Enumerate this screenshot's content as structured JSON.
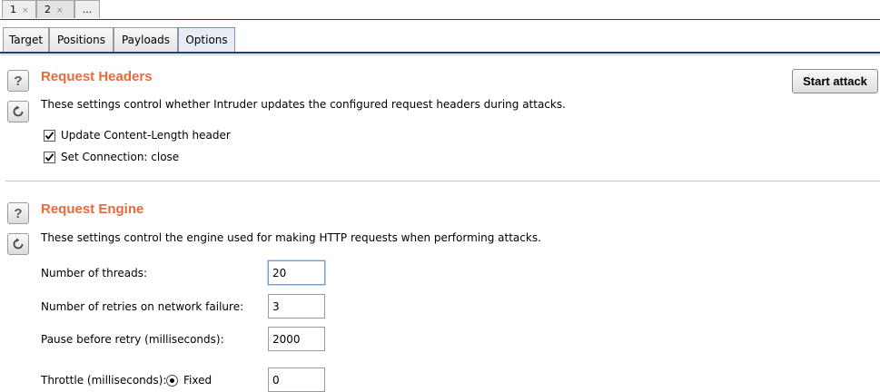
{
  "instance_tabs": [
    {
      "label": "1",
      "close": "×"
    },
    {
      "label": "2",
      "close": "×"
    },
    {
      "label": "..."
    }
  ],
  "sub_tabs": [
    "Target",
    "Positions",
    "Payloads",
    "Options"
  ],
  "active_sub_tab": "Options",
  "start_attack_label": "Start attack",
  "request_headers": {
    "title": "Request Headers",
    "description": "These settings control whether Intruder updates the configured request headers during attacks.",
    "options": [
      {
        "label": "Update Content-Length header",
        "checked": true
      },
      {
        "label": "Set Connection: close",
        "checked": true
      }
    ]
  },
  "request_engine": {
    "title": "Request Engine",
    "description": "These settings control the engine used for making HTTP requests when performing attacks.",
    "threads": {
      "label": "Number of threads:",
      "value": "20"
    },
    "retries": {
      "label": "Number of retries on network failure:",
      "value": "3"
    },
    "pause": {
      "label": "Pause before retry (milliseconds):",
      "value": "2000"
    },
    "throttle": {
      "label": "Throttle (milliseconds):",
      "mode": "Fixed",
      "value": "0"
    }
  },
  "icons": {
    "help": "help-icon",
    "reset": "reset-icon"
  },
  "colors": {
    "section_title": "#e8693b",
    "tab_underline": "#1b3e79"
  }
}
